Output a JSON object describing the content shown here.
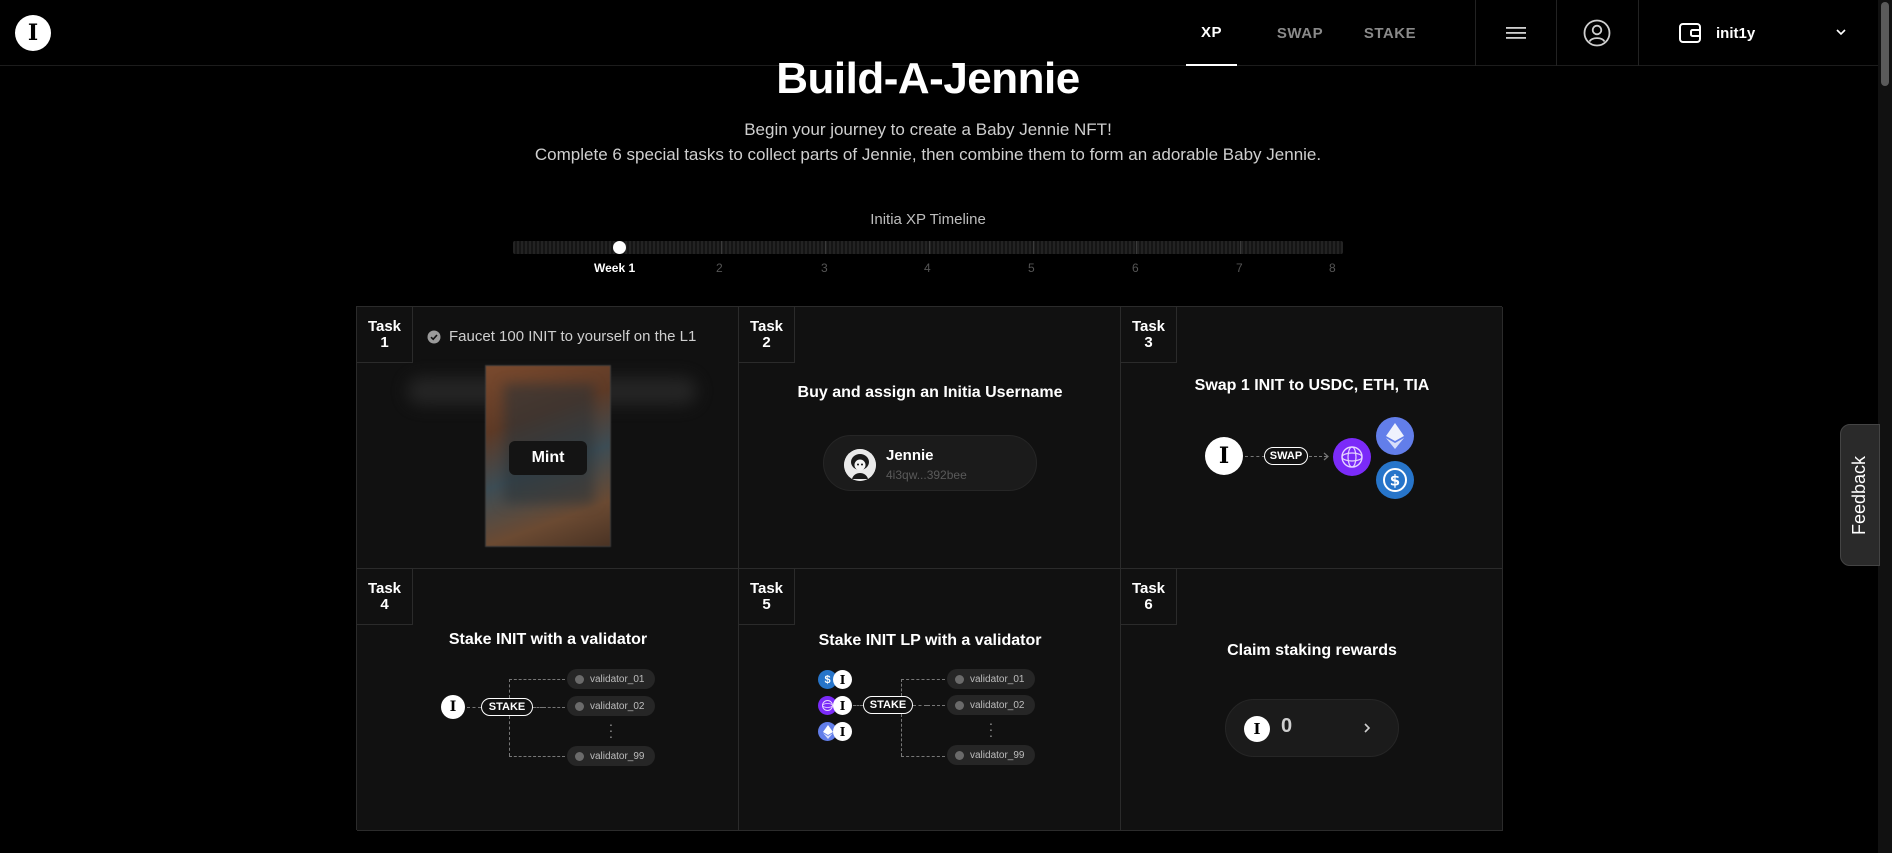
{
  "header": {
    "logo_icon": "initia-logo-icon",
    "tabs": [
      {
        "label": "XP",
        "active": true
      },
      {
        "label": "SWAP",
        "active": false
      },
      {
        "label": "STAKE",
        "active": false
      }
    ],
    "menu_icon": "hamburger-menu-icon",
    "user_icon": "user-circle-icon",
    "wallet": {
      "icon": "wallet-icon",
      "address": "init1y",
      "chevron": "chevron-down-icon"
    }
  },
  "hero": {
    "title": "Build-A-Jennie",
    "subtitle_line1": "Begin your journey to create a Baby Jennie NFT!",
    "subtitle_line2": "Complete 6 special tasks to collect parts of Jennie, then combine them to form an adorable Baby Jennie."
  },
  "timeline": {
    "label": "Initia XP Timeline",
    "weeks": [
      "Week 1",
      "2",
      "3",
      "4",
      "5",
      "6",
      "7",
      "8"
    ],
    "current_week_index": 0
  },
  "tasks": [
    {
      "tag_word": "Task",
      "tag_num": "1",
      "title": "Faucet 100 INIT to yourself on the L1",
      "completed": true,
      "mint_label": "Mint"
    },
    {
      "tag_word": "Task",
      "tag_num": "2",
      "title": "Buy and assign an Initia Username",
      "username": "Jennie",
      "address": "4i3qw...392bee"
    },
    {
      "tag_word": "Task",
      "tag_num": "3",
      "title": "Swap 1 INIT to USDC, ETH, TIA",
      "swap_label": "SWAP",
      "tokens": [
        "tia-icon",
        "eth-icon",
        "usdc-icon"
      ]
    },
    {
      "tag_word": "Task",
      "tag_num": "4",
      "title": "Stake INIT with a validator",
      "stake_label": "STAKE",
      "validators": [
        "validator_01",
        "validator_02",
        "validator_99"
      ]
    },
    {
      "tag_word": "Task",
      "tag_num": "5",
      "title": "Stake INIT LP with a validator",
      "stake_label": "STAKE",
      "validators": [
        "validator_01",
        "validator_02",
        "validator_99"
      ]
    },
    {
      "tag_word": "Task",
      "tag_num": "6",
      "title": "Claim staking rewards",
      "reward_amount": "0"
    }
  ],
  "feedback": {
    "label": "Feedback"
  },
  "colors": {
    "background": "#000000",
    "panel": "#111111",
    "border": "#2b2b2b",
    "tia": "#7b2bf9",
    "eth": "#627eea",
    "usdc": "#2775ca"
  }
}
